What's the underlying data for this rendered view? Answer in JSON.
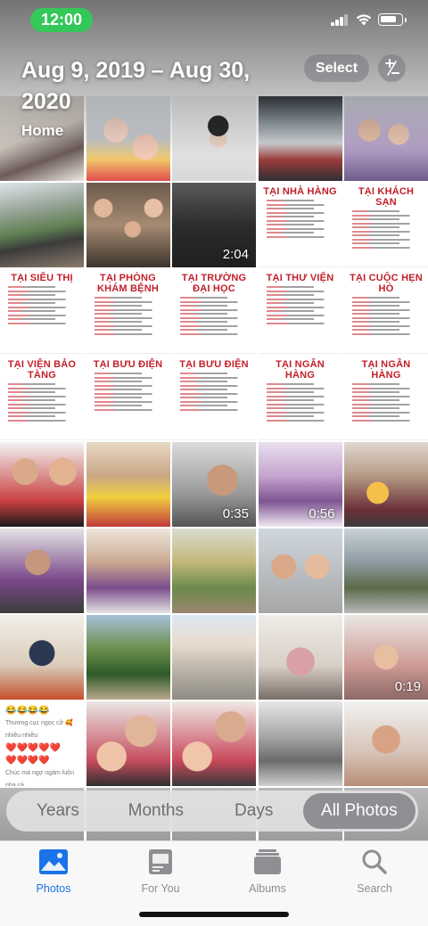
{
  "status_bar": {
    "time": "12:00"
  },
  "header": {
    "title": "Aug 9, 2019 – Aug 30, 2020",
    "location": "Home",
    "select_label": "Select"
  },
  "grid": {
    "doc_titles": [
      "TẠI NHÀ HÀNG",
      "TẠI KHÁCH SẠN",
      "TẠI SIÊU THỊ",
      "TẠI PHÒNG KHÁM BỆNH",
      "TẠI TRƯỜNG ĐẠI HỌC",
      "TẠI THƯ VIỆN",
      "TẠI CUỘC HẸN HÒ",
      "TẠI VIỆN BẢO TÀNG",
      "TẠI BƯU ĐIỆN",
      "TẠI BƯU ĐIỆN",
      "TẠI NGÂN HÀNG",
      "TẠI NGÂN HÀNG"
    ],
    "durations": [
      "2:04",
      "0:35",
      "0:56",
      "0:19"
    ],
    "message_lines": [
      "😂😂😂😂",
      "Thương cục ngọc cỡ 🥰 nhiều nhiều",
      "❤️❤️❤️❤️❤️",
      "❤️❤️❤️❤️",
      "Chúc mà ngợ ngàm luôn nha cả",
      "😂😂😂😂",
      "😍 💖 🌸"
    ]
  },
  "segmented": {
    "items": [
      "Years",
      "Months",
      "Days",
      "All Photos"
    ],
    "selected": "All Photos"
  },
  "tabbar": {
    "items": [
      "Photos",
      "For You",
      "Albums",
      "Search"
    ],
    "selected": "Photos"
  },
  "colors": {
    "accent": "#1a73e8",
    "status_pill": "#34c759",
    "doc_title": "#c2202b"
  }
}
